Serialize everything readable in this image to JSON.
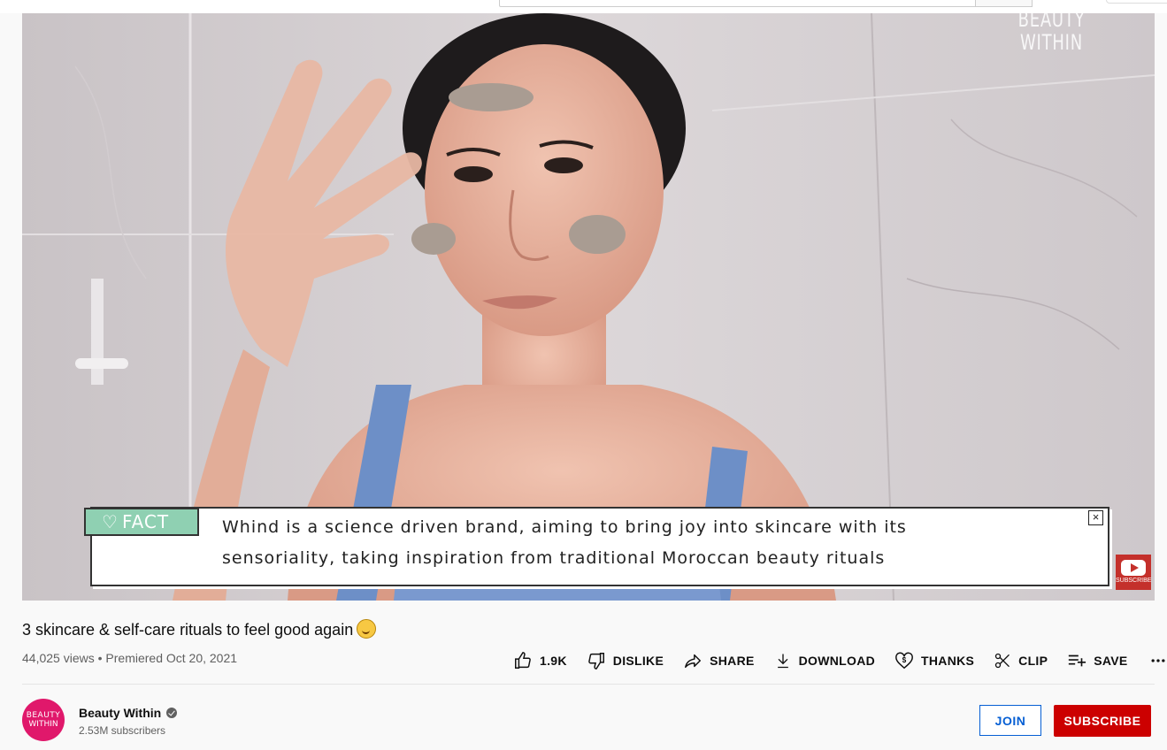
{
  "player": {
    "watermark_line1": "BEAUTY",
    "watermark_line2": "WITHIN",
    "subscribe_badge": "SUBSCRIBE",
    "fact_label": "FACT",
    "fact_line1": "Whind is a science driven brand, aiming to bring joy into skincare with its",
    "fact_line2": "sensoriality, taking inspiration from traditional Moroccan beauty rituals",
    "fact_close": "×"
  },
  "video": {
    "title": "3 skincare & self-care rituals to feel good again",
    "views": "44,025 views",
    "separator": "•",
    "premiered": "Premiered Oct 20, 2021"
  },
  "actions": {
    "like_count": "1.9K",
    "dislike": "DISLIKE",
    "share": "SHARE",
    "download": "DOWNLOAD",
    "thanks": "THANKS",
    "clip": "CLIP",
    "save": "SAVE"
  },
  "channel": {
    "avatar_line1": "BEAUTY",
    "avatar_line2": "WITHIN",
    "name": "Beauty Within",
    "subscribers": "2.53M subscribers",
    "join_label": "JOIN",
    "subscribe_label": "SUBSCRIBE"
  },
  "colors": {
    "subscribe_red": "#cc0000",
    "join_blue": "#065fd4",
    "fact_green": "#8fd0b2",
    "avatar_pink": "#e0186b"
  }
}
